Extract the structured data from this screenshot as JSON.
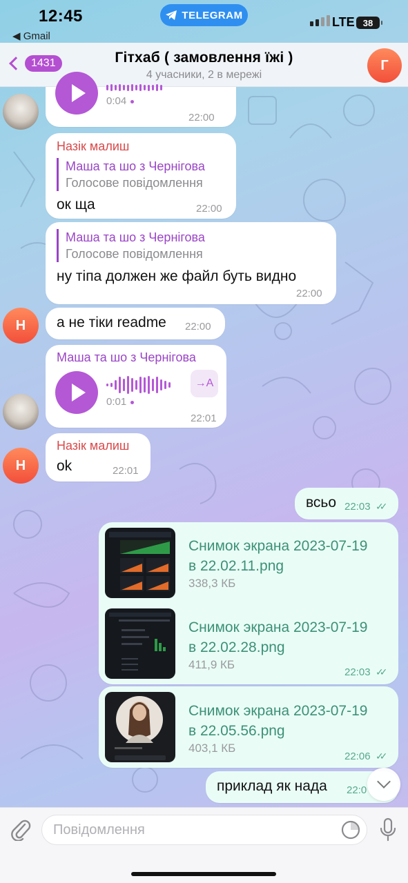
{
  "status_bar": {
    "time": "12:45",
    "back_app": "◀ Gmail",
    "telegram_pill": "TELEGRAM",
    "network": "LTE",
    "battery": "38"
  },
  "header": {
    "back_count": "1431",
    "title": "Гітхаб ( замовлення їжі )",
    "subtitle": "4 учасники, 2 в мережі",
    "avatar_letter": "Г"
  },
  "messages": {
    "m0": {
      "duration": "0:04",
      "time": "22:00"
    },
    "m1": {
      "sender": "Назік малиш",
      "reply_name": "Маша та шо з Чернігова",
      "reply_text": "Голосове повідомлення",
      "text": "ок ща",
      "time": "22:00"
    },
    "m2": {
      "reply_name": "Маша та шо з Чернігова",
      "reply_text": "Голосове повідомлення",
      "text": "ну тіпа должен же файл буть видно",
      "time": "22:00"
    },
    "m3": {
      "avatar": "Н",
      "text": "а не тіки readme",
      "time": "22:00"
    },
    "m4": {
      "sender": "Маша та шо з Чернігова",
      "duration": "0:01",
      "transcribe": "→A",
      "time": "22:01"
    },
    "m5": {
      "sender": "Назік малиш",
      "avatar": "Н",
      "text": "ok",
      "time": "22:01"
    },
    "m6": {
      "text": "всьо",
      "time": "22:03"
    },
    "files": [
      {
        "name_line1": "Снимок экрана 2023-07-19",
        "name_line2": "в 22.02.11.png",
        "size": "338,3 КБ"
      },
      {
        "name_line1": "Снимок экрана 2023-07-19",
        "name_line2": "в 22.02.28.png",
        "size": "411,9 КБ",
        "time": "22:03"
      },
      {
        "name_line1": "Снимок экрана 2023-07-19",
        "name_line2": "в 22.05.56.png",
        "size": "403,1 КБ",
        "time": "22:06"
      }
    ],
    "m8": {
      "text": "приклад як нада",
      "time": "22:0"
    }
  },
  "input": {
    "placeholder": "Повідомлення"
  },
  "icons": [
    "telegram-icon",
    "attach-icon",
    "sticker-icon",
    "mic-icon",
    "chevron-down-icon",
    "play-icon",
    "transcribe-icon",
    "read-checks-icon"
  ]
}
